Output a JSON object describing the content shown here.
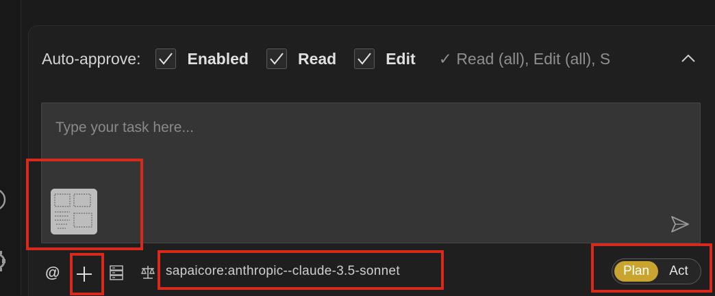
{
  "auto_approve": {
    "label": "Auto-approve:",
    "options": [
      {
        "label": "Enabled",
        "checked": true
      },
      {
        "label": "Read",
        "checked": true
      },
      {
        "label": "Edit",
        "checked": true
      }
    ],
    "summary": "✓ Read (all), Edit (all), S"
  },
  "task": {
    "placeholder": "Type your task here..."
  },
  "toolbar": {
    "model": "sapaicore:anthropic--claude-3.5-sonnet",
    "mention_symbol": "@"
  },
  "mode": {
    "plan_label": "Plan",
    "act_label": "Act",
    "active": "Plan"
  },
  "colors": {
    "highlight_border": "#d9291c",
    "plan_active": "#c9a530",
    "background": "#1b1b1b"
  },
  "icons": [
    "circle-icon",
    "gear-icon",
    "chevron-up-icon",
    "send-icon",
    "image-thumbnail",
    "at-icon",
    "plus-icon",
    "server-icon",
    "scale-icon"
  ]
}
